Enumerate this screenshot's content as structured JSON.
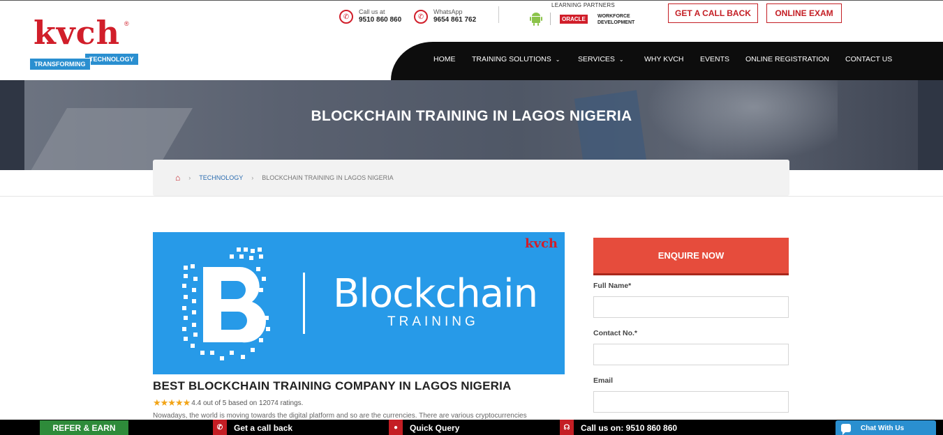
{
  "brand": {
    "logo_word": "kvch",
    "logo_reg": "®",
    "tagline_left": "TRANSFORMING",
    "tagline_right": "TECHNOLOGY"
  },
  "topbar": {
    "call": {
      "label": "Call us at",
      "number": "9510 860 860"
    },
    "whatsapp": {
      "label": "WhatsApp",
      "number": "9654 861 762"
    },
    "partners_label": "LEARNING PARTNERS",
    "oracle_logo": "ORACLE",
    "oracle_text_1": "WORKFORCE",
    "oracle_text_2": "DEVELOPMENT",
    "get_call_back": "GET A CALL BACK",
    "online_exam": "ONLINE EXAM"
  },
  "nav": {
    "items": [
      {
        "label": "HOME",
        "caret": ""
      },
      {
        "label": "TRAINING SOLUTIONS",
        "caret": "⌄"
      },
      {
        "label": "SERVICES",
        "caret": "⌄"
      },
      {
        "label": "WHY KVCH",
        "caret": ""
      },
      {
        "label": "EVENTS",
        "caret": ""
      },
      {
        "label": "ONLINE REGISTRATION",
        "caret": ""
      },
      {
        "label": "CONTACT US",
        "caret": ""
      }
    ]
  },
  "banner": {
    "title": "BLOCKCHAIN TRAINING IN LAGOS NIGERIA"
  },
  "breadcrumb": {
    "home_icon": "⌂",
    "sep": "›",
    "link": "TECHNOLOGY",
    "current": "BLOCKCHAIN TRAINING IN LAGOS NIGERIA"
  },
  "hero": {
    "kvch": "kvch",
    "word": "Blockchain",
    "sub": "TRAINING"
  },
  "course": {
    "title": "BEST BLOCKCHAIN TRAINING COMPANY IN LAGOS NIGERIA",
    "stars": "★★★★★",
    "rating_text": "4.4 out of 5 based on 12074 ratings.",
    "intro": "Nowadays, the world is moving towards the digital platform and so are the currencies. There are various cryptocurrencies"
  },
  "form": {
    "button": "ENQUIRE NOW",
    "full_name_label": "Full Name*",
    "contact_label": "Contact No.*",
    "email_label": "Email"
  },
  "bottom": {
    "refer": "REFER & EARN",
    "call_back": "Get a call back",
    "quick_query": "Quick Query",
    "call_us": "Call us on: 9510 860 860",
    "chat": "Chat With Us"
  },
  "colors": {
    "brand_red": "#c41e24",
    "nav_black": "#0d0d0d",
    "hero_blue": "#279ae8",
    "enquire_red": "#e64c3c",
    "refer_green": "#2e8b3a",
    "chat_blue": "#2a8fd0"
  }
}
